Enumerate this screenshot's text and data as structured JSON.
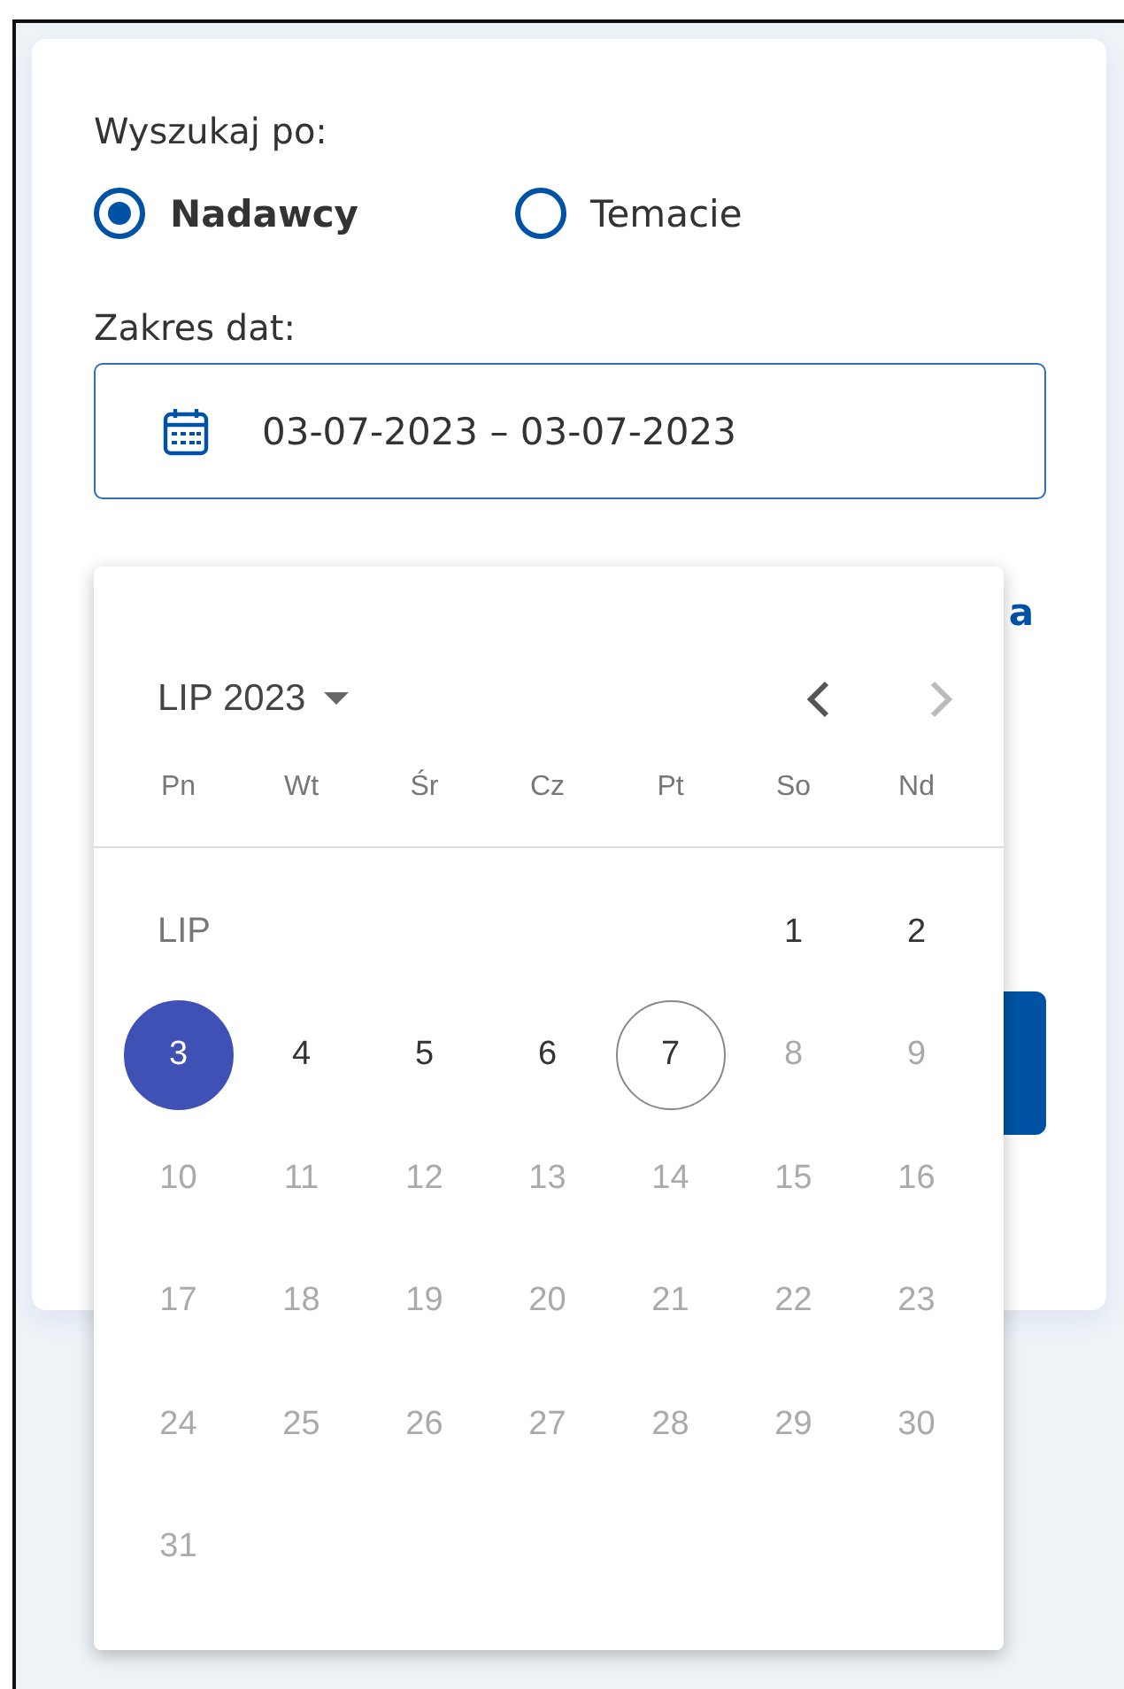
{
  "search_by": {
    "label": "Wyszukaj po:",
    "options": [
      {
        "label": "Nadawcy",
        "selected": true
      },
      {
        "label": "Temacie",
        "selected": false
      }
    ]
  },
  "date_range": {
    "label": "Zakres dat:",
    "value": "03-07-2023 – 03-07-2023"
  },
  "partial_link": "a",
  "datepicker": {
    "period_button": "LIP 2023",
    "prev_disabled": false,
    "next_disabled": true,
    "weekdays": [
      "Pn",
      "Wt",
      "Śr",
      "Cz",
      "Pt",
      "So",
      "Nd"
    ],
    "weeks": [
      {
        "label": "LIP",
        "days": [
          {
            "label": "1",
            "selected": false,
            "today": false,
            "disabled": false
          },
          {
            "label": "2",
            "selected": false,
            "today": false,
            "disabled": false
          }
        ]
      },
      {
        "days": [
          {
            "label": "3",
            "selected": true,
            "today": false,
            "disabled": false
          },
          {
            "label": "4",
            "selected": false,
            "today": false,
            "disabled": false
          },
          {
            "label": "5",
            "selected": false,
            "today": false,
            "disabled": false
          },
          {
            "label": "6",
            "selected": false,
            "today": false,
            "disabled": false
          },
          {
            "label": "7",
            "selected": false,
            "today": true,
            "disabled": false
          },
          {
            "label": "8",
            "selected": false,
            "today": false,
            "disabled": true
          },
          {
            "label": "9",
            "selected": false,
            "today": false,
            "disabled": true
          }
        ]
      },
      {
        "days": [
          {
            "label": "10",
            "selected": false,
            "today": false,
            "disabled": true
          },
          {
            "label": "11",
            "selected": false,
            "today": false,
            "disabled": true
          },
          {
            "label": "12",
            "selected": false,
            "today": false,
            "disabled": true
          },
          {
            "label": "13",
            "selected": false,
            "today": false,
            "disabled": true
          },
          {
            "label": "14",
            "selected": false,
            "today": false,
            "disabled": true
          },
          {
            "label": "15",
            "selected": false,
            "today": false,
            "disabled": true
          },
          {
            "label": "16",
            "selected": false,
            "today": false,
            "disabled": true
          }
        ]
      },
      {
        "days": [
          {
            "label": "17",
            "selected": false,
            "today": false,
            "disabled": true
          },
          {
            "label": "18",
            "selected": false,
            "today": false,
            "disabled": true
          },
          {
            "label": "19",
            "selected": false,
            "today": false,
            "disabled": true
          },
          {
            "label": "20",
            "selected": false,
            "today": false,
            "disabled": true
          },
          {
            "label": "21",
            "selected": false,
            "today": false,
            "disabled": true
          },
          {
            "label": "22",
            "selected": false,
            "today": false,
            "disabled": true
          },
          {
            "label": "23",
            "selected": false,
            "today": false,
            "disabled": true
          }
        ]
      },
      {
        "days": [
          {
            "label": "24",
            "selected": false,
            "today": false,
            "disabled": true
          },
          {
            "label": "25",
            "selected": false,
            "today": false,
            "disabled": true
          },
          {
            "label": "26",
            "selected": false,
            "today": false,
            "disabled": true
          },
          {
            "label": "27",
            "selected": false,
            "today": false,
            "disabled": true
          },
          {
            "label": "28",
            "selected": false,
            "today": false,
            "disabled": true
          },
          {
            "label": "29",
            "selected": false,
            "today": false,
            "disabled": true
          },
          {
            "label": "30",
            "selected": false,
            "today": false,
            "disabled": true
          }
        ]
      },
      {
        "days": [
          {
            "label": "31",
            "selected": false,
            "today": false,
            "disabled": true
          }
        ]
      }
    ]
  }
}
